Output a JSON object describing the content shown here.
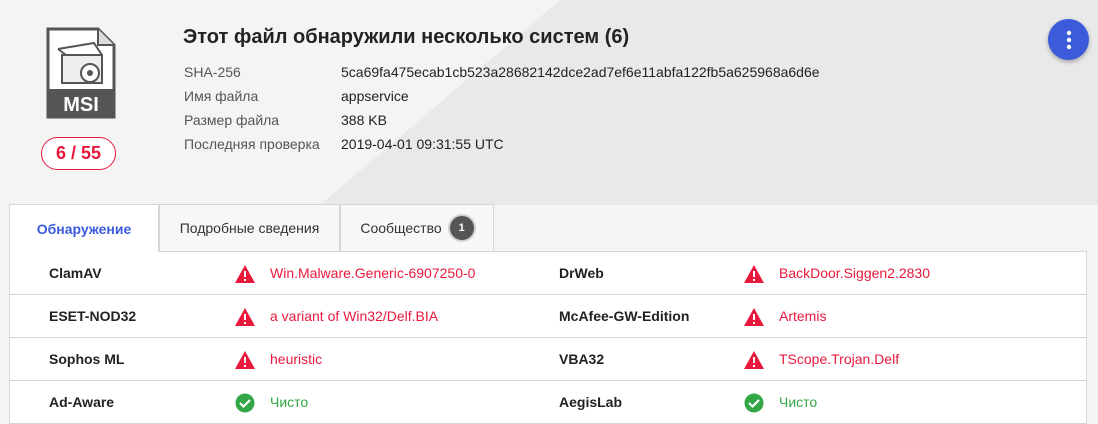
{
  "file": {
    "icon_label": "MSI",
    "score": "6 / 55",
    "title": "Этот файл обнаружили несколько систем (6)",
    "meta": [
      {
        "label": "SHA-256",
        "value": "5ca69fa475ecab1cb523a28682142dce2ad7ef6e11abfa122fb5a625968a6d6e"
      },
      {
        "label": "Имя файла",
        "value": "appservice"
      },
      {
        "label": "Размер файла",
        "value": "388 KB"
      },
      {
        "label": "Последняя проверка",
        "value": "2019-04-01 09:31:55 UTC"
      }
    ]
  },
  "menu": {
    "icon": "more-vertical-icon"
  },
  "tabs": [
    {
      "label": "Обнаружение",
      "active": true
    },
    {
      "label": "Подробные сведения",
      "active": false
    },
    {
      "label": "Сообщество",
      "active": false,
      "badge": "1"
    }
  ],
  "detections": [
    {
      "left": {
        "engine": "ClamAV",
        "status": "malicious",
        "result": "Win.Malware.Generic-6907250-0"
      },
      "right": {
        "engine": "DrWeb",
        "status": "malicious",
        "result": "BackDoor.Siggen2.2830"
      }
    },
    {
      "left": {
        "engine": "ESET-NOD32",
        "status": "malicious",
        "result": "a variant of Win32/Delf.BIA"
      },
      "right": {
        "engine": "McAfee-GW-Edition",
        "status": "malicious",
        "result": "Artemis"
      }
    },
    {
      "left": {
        "engine": "Sophos ML",
        "status": "malicious",
        "result": "heuristic"
      },
      "right": {
        "engine": "VBA32",
        "status": "malicious",
        "result": "TScope.Trojan.Delf"
      }
    },
    {
      "left": {
        "engine": "Ad-Aware",
        "status": "clean",
        "result": "Чисто"
      },
      "right": {
        "engine": "AegisLab",
        "status": "clean",
        "result": "Чисто"
      }
    }
  ],
  "colors": {
    "malicious": "#e8193c",
    "clean": "#33a745",
    "accent": "#3b5bdb"
  }
}
